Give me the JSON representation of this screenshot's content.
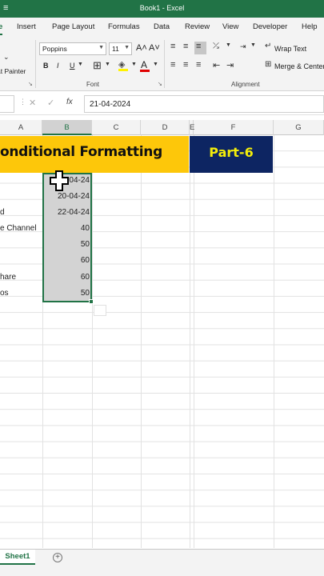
{
  "window": {
    "title": "Book1 - Excel"
  },
  "ribbon_tabs": [
    "e",
    "Insert",
    "Page Layout",
    "Formulas",
    "Data",
    "Review",
    "View",
    "Developer",
    "Help"
  ],
  "ribbon": {
    "format_painter": "at Painter",
    "font_name": "Poppins",
    "font_size": "11",
    "bold": "B",
    "italic": "I",
    "underline": "U",
    "grow_font": "A˄",
    "shrink_font": "A˅",
    "font_group_label": "Font",
    "wrap_text": "Wrap Text",
    "merge_center": "Merge & Center",
    "alignment_group_label": "Alignment"
  },
  "formula_bar": {
    "fx": "fx",
    "value": "21-04-2024"
  },
  "columns": [
    "A",
    "B",
    "C",
    "D",
    "E",
    "F",
    "G"
  ],
  "banner": {
    "title": "onditional Formatting",
    "part": "Part-6"
  },
  "rows": [
    {
      "a": "",
      "b": "04-24"
    },
    {
      "a": "",
      "b": "20-04-24"
    },
    {
      "a": "d",
      "b": "22-04-24"
    },
    {
      "a": "e Channel",
      "b": "40"
    },
    {
      "a": "",
      "b": "50"
    },
    {
      "a": "",
      "b": "60"
    },
    {
      "a": "hare",
      "b": "60"
    },
    {
      "a": "os",
      "b": "50"
    }
  ],
  "sheets": [
    "Sheet1"
  ],
  "colors": {
    "excel_green": "#217346",
    "banner_yellow": "#fdc70a",
    "banner_navy": "#0d2562",
    "banner_text": "#f3ed0a"
  }
}
